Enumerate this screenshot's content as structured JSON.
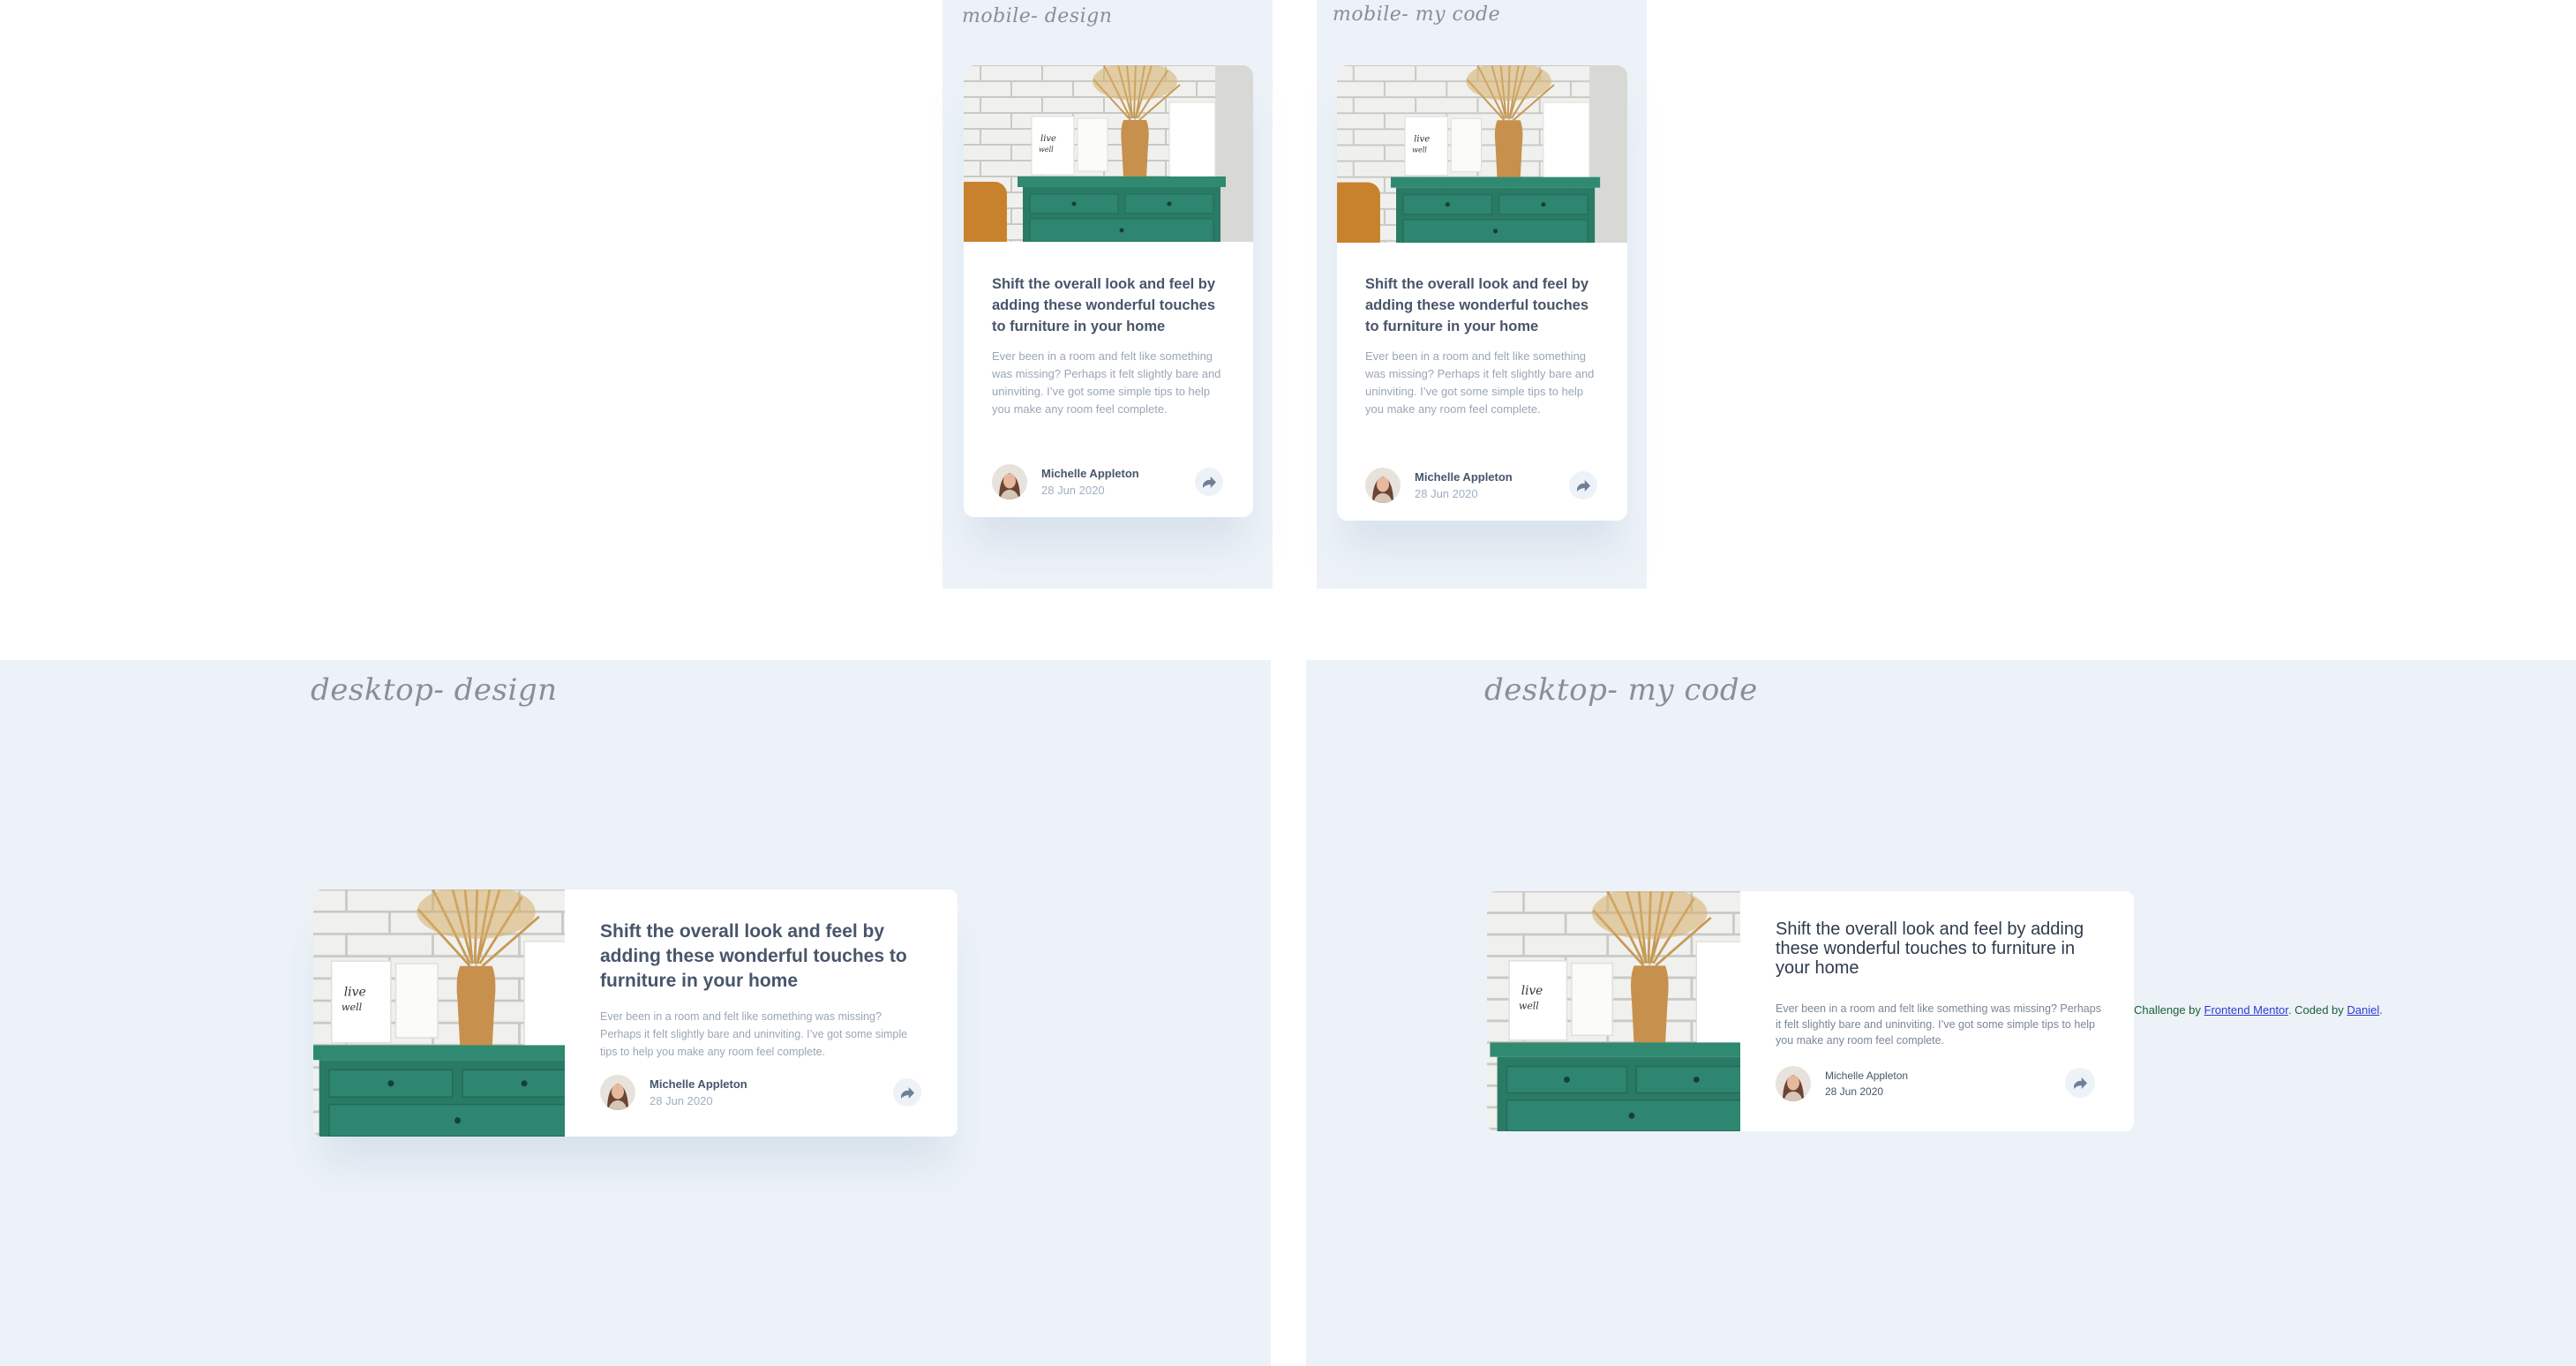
{
  "labels": {
    "mobile_design": "mobile- design",
    "mobile_code": "mobile- my code",
    "desktop_design": "desktop- design",
    "desktop_code": "desktop- my code"
  },
  "card": {
    "title": "Shift the overall look and feel by adding these wonderful touches to furniture in your home",
    "description": "Ever been in a room and felt like something was missing? Perhaps it felt slightly bare and uninviting. I’ve got some simple tips to help you make any room feel complete.",
    "author_name": "Michelle Appleton",
    "author_date": "28 Jun 2020",
    "image_icon": "drawers-photo",
    "avatar_icon": "avatar-photo",
    "share_icon": "share-icon"
  },
  "attribution": {
    "prefix": "Challenge by",
    "link1": "Frontend Mentor",
    "middle": ". Coded by",
    "link2": "Daniel",
    "suffix": "."
  },
  "colors": {
    "background": "#ecf2f8",
    "card": "#ffffff",
    "title": "#48556a",
    "text": "#9aa6b4",
    "date": "#9eafc2",
    "drawer_green": "#2a7b66"
  }
}
